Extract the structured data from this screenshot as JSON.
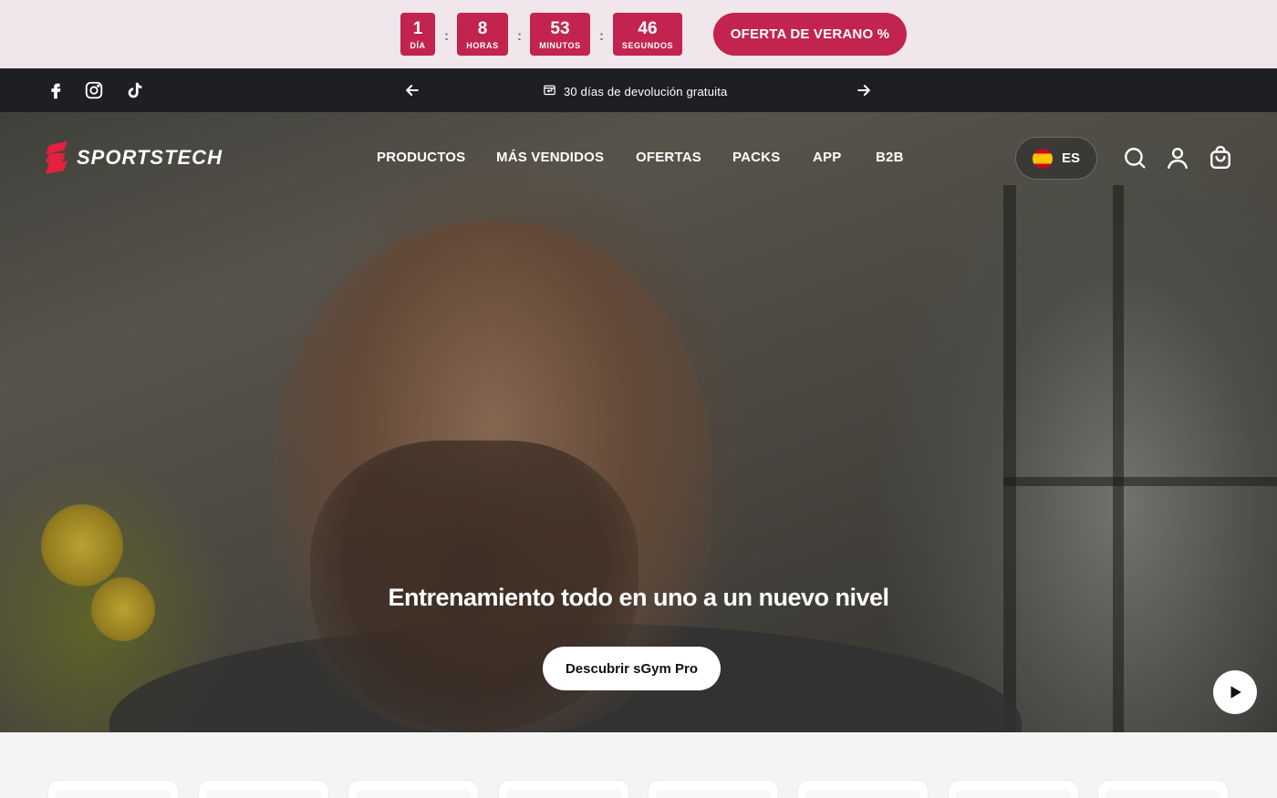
{
  "countdown": {
    "units": [
      {
        "value": "1",
        "label": "DÍA"
      },
      {
        "value": "8",
        "label": "HORAS"
      },
      {
        "value": "53",
        "label": "MINUTOS"
      },
      {
        "value": "46",
        "label": "SEGUNDOS"
      }
    ],
    "separator": ":",
    "offer_label": "OFERTA DE VERANO %"
  },
  "announcement": {
    "message": "30 días de devolución gratuita",
    "social": [
      "facebook-icon",
      "instagram-icon",
      "tiktok-icon"
    ]
  },
  "header": {
    "brand": "SPORTSTECH",
    "nav": [
      "PRODUCTOS",
      "MÁS VENDIDOS",
      "OFERTAS",
      "PACKS",
      "APP",
      "B2B"
    ],
    "language": "ES"
  },
  "hero": {
    "title": "Entrenamiento todo en uno a un nuevo nivel",
    "cta": "Descubrir sGym Pro"
  },
  "colors": {
    "accent": "#c2244f",
    "topbar_bg": "#f0e6eb",
    "announcement_bg": "#1d1f23"
  }
}
